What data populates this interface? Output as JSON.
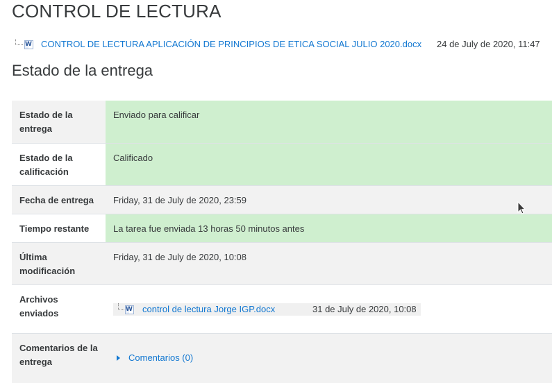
{
  "page": {
    "title": "CONTROL DE LECTURA"
  },
  "intro_attachment": {
    "icon": "word-doc-icon",
    "filename": "CONTROL DE LECTURA APLICACIÓN DE PRINCIPIOS DE ETICA SOCIAL JULIO 2020.docx",
    "date": "24 de July de 2020, 11:47"
  },
  "submission": {
    "heading": "Estado de la entrega",
    "rows": [
      {
        "label": "Estado de la entrega",
        "value": "Enviado para calificar",
        "highlight": "green"
      },
      {
        "label": "Estado de la calificación",
        "value": "Calificado",
        "highlight": "green"
      },
      {
        "label": "Fecha de entrega",
        "value": "Friday, 31 de July de 2020, 23:59"
      },
      {
        "label": "Tiempo restante",
        "value": "La tarea fue enviada 13 horas 50 minutos antes",
        "highlight": "green"
      },
      {
        "label": "Última modificación",
        "value": "Friday, 31 de July de 2020, 10:08"
      },
      {
        "label": "Archivos enviados",
        "file": {
          "icon": "word-doc-icon",
          "filename": "control de lectura Jorge IGP.docx",
          "date": "31 de July de 2020, 10:08"
        }
      },
      {
        "label": "Comentarios de la entrega",
        "comments_link": "Comentarios (0)"
      }
    ]
  },
  "colors": {
    "link": "#1177d1",
    "success_bg": "#cfefcf",
    "stripe_bg": "#f2f2f2",
    "text": "#373a3c"
  }
}
